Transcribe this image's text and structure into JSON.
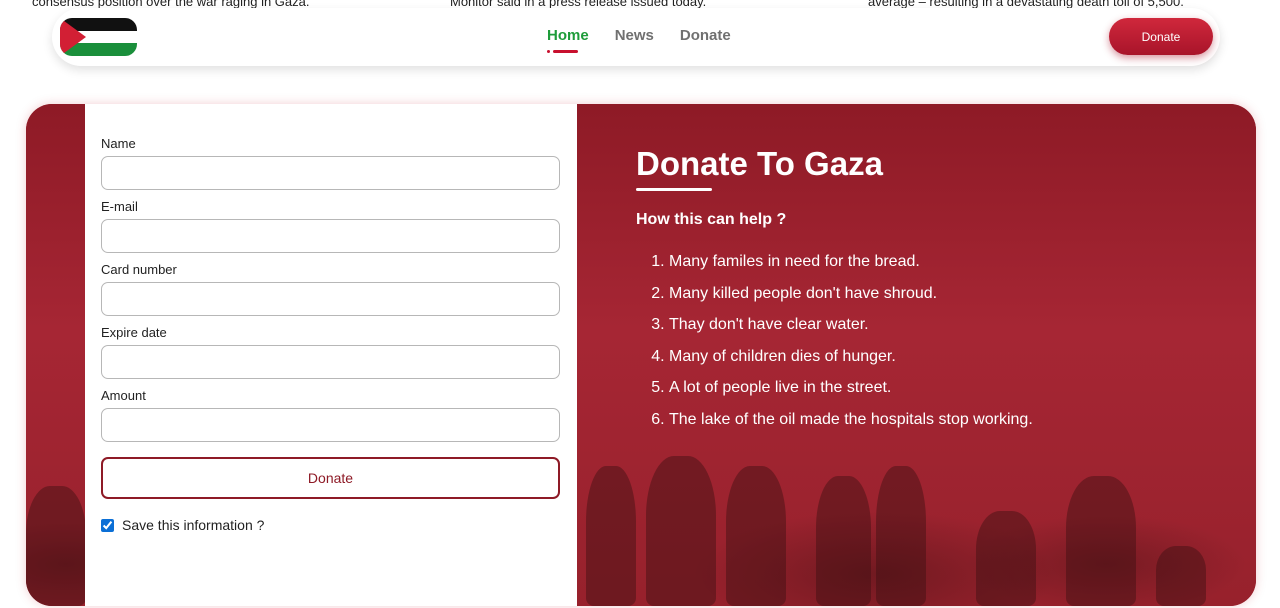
{
  "background_text": {
    "col1": "consensus position over the war raging in Gaza.",
    "col2": "Monitor said in a press release issued today.",
    "col3": "average – resulting in a devastating death toll of 5,500."
  },
  "nav": {
    "flag_icon": "palestine-flag-icon",
    "links": [
      {
        "label": "Home",
        "active": true
      },
      {
        "label": "News",
        "active": false
      },
      {
        "label": "Donate",
        "active": false
      }
    ],
    "cta_label": "Donate"
  },
  "form": {
    "fields": [
      {
        "label": "Name",
        "value": "",
        "placeholder": ""
      },
      {
        "label": "E-mail",
        "value": "",
        "placeholder": ""
      },
      {
        "label": "Card number",
        "value": "",
        "placeholder": ""
      },
      {
        "label": "Expire date",
        "value": "",
        "placeholder": ""
      },
      {
        "label": "Amount",
        "value": "",
        "placeholder": ""
      }
    ],
    "submit_label": "Donate",
    "save_label": "Save this information ?",
    "save_checked": true
  },
  "info": {
    "title": "Donate To Gaza",
    "subtitle": "How this can help ?",
    "items": [
      "Many familes in need for the bread.",
      "Many killed people don't have shroud.",
      "Thay don't have clear water.",
      "Many of children dies of hunger.",
      "A lot of people live in the street.",
      "The lake of the oil made the hospitals stop working."
    ]
  },
  "colors": {
    "accent_green": "#1e9c3a",
    "accent_red": "#c8102e",
    "panel_red": "#9b1f2c",
    "button_border": "#8e1a26"
  }
}
